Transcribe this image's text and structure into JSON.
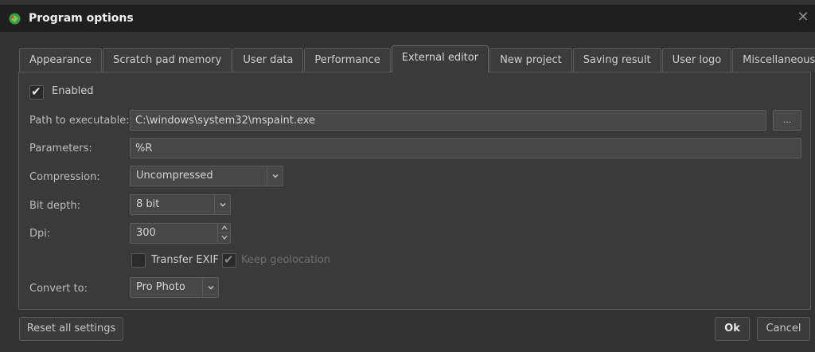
{
  "window": {
    "title": "Program options",
    "close_glyph": "✕"
  },
  "tabs": [
    {
      "label": "Appearance"
    },
    {
      "label": "Scratch pad memory"
    },
    {
      "label": "User data"
    },
    {
      "label": "Performance"
    },
    {
      "label": "External editor",
      "active": true
    },
    {
      "label": "New project"
    },
    {
      "label": "Saving result"
    },
    {
      "label": "User logo"
    },
    {
      "label": "Miscellaneous"
    }
  ],
  "editor": {
    "enabled_label": "Enabled",
    "enabled_checked": true,
    "path_label": "Path to executable:",
    "path_value": "C:\\windows\\system32\\mspaint.exe",
    "browse_label": "...",
    "params_label": "Parameters:",
    "params_value": "%R",
    "compression_label": "Compression:",
    "compression_value": "Uncompressed",
    "bitdepth_label": "Bit depth:",
    "bitdepth_value": "8 bit",
    "dpi_label": "Dpi:",
    "dpi_value": "300",
    "transfer_exif_label": "Transfer EXIF",
    "transfer_exif_checked": false,
    "keep_geo_label": "Keep geolocation",
    "keep_geo_checked": true,
    "convert_label": "Convert to:",
    "convert_value": "Pro Photo"
  },
  "buttons": {
    "reset": "Reset all settings",
    "ok": "Ok",
    "cancel": "Cancel"
  },
  "icons": {
    "app": "app-logo-icon",
    "check": "✔",
    "chevron_down": "⌄",
    "spin_up": "▲",
    "spin_down": "▼"
  }
}
